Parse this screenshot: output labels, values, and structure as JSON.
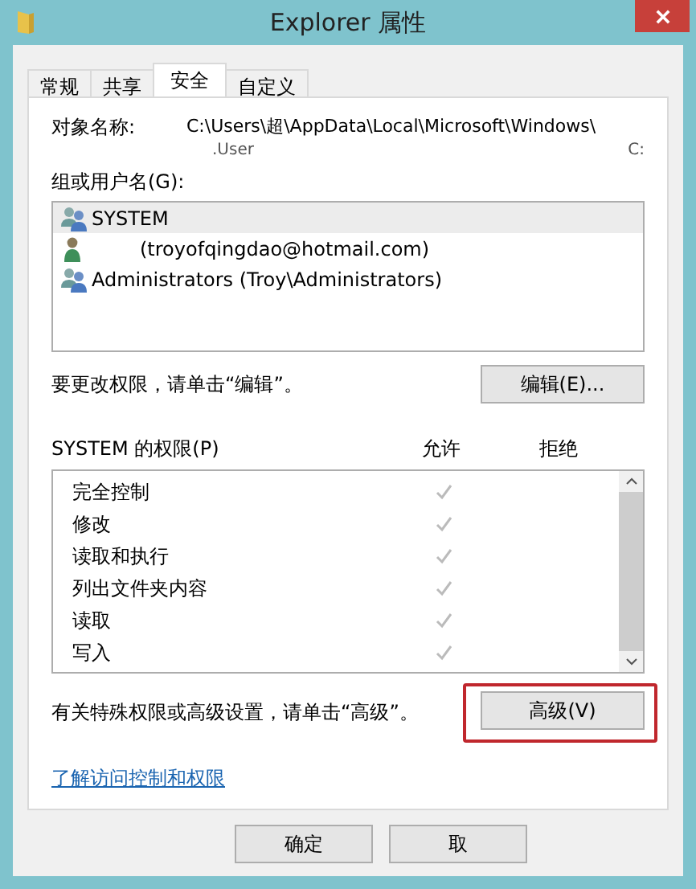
{
  "window": {
    "title": "Explorer 属性"
  },
  "tabs": [
    {
      "label": "常规",
      "selected": false
    },
    {
      "label": "共享",
      "selected": false
    },
    {
      "label": "安全",
      "selected": true
    },
    {
      "label": "自定义",
      "selected": false
    }
  ],
  "object_name": {
    "label": "对象名称:",
    "value": "C:\\Users\\超\\AppData\\Local\\Microsoft\\Windows\\",
    "fragments": [
      ".User",
      "C:"
    ]
  },
  "users": {
    "label": "组或用户名(G):",
    "items": [
      {
        "name": "SYSTEM",
        "kind": "group",
        "selected": true
      },
      {
        "name": "(troyofqingdao@hotmail.com)",
        "kind": "user",
        "selected": false
      },
      {
        "name": "Administrators (Troy\\Administrators)",
        "kind": "group",
        "selected": false
      }
    ]
  },
  "edit_hint": "要更改权限，请单击“编辑”。",
  "edit_button": "编辑(E)...",
  "permissions": {
    "label": "SYSTEM 的权限(P)",
    "columns": [
      "允许",
      "拒绝"
    ],
    "rows": [
      {
        "name": "完全控制",
        "allow": true
      },
      {
        "name": "修改",
        "allow": true
      },
      {
        "name": "读取和执行",
        "allow": true
      },
      {
        "name": "列出文件夹内容",
        "allow": true
      },
      {
        "name": "读取",
        "allow": true
      },
      {
        "name": "写入",
        "allow": true
      }
    ]
  },
  "advanced_hint": "有关特殊权限或高级设置，请单击“高级”。",
  "advanced_button": {
    "label": "高级(V)",
    "highlighted": true
  },
  "link": "了解访问控制和权限",
  "buttons": [
    "确定",
    "取"
  ]
}
